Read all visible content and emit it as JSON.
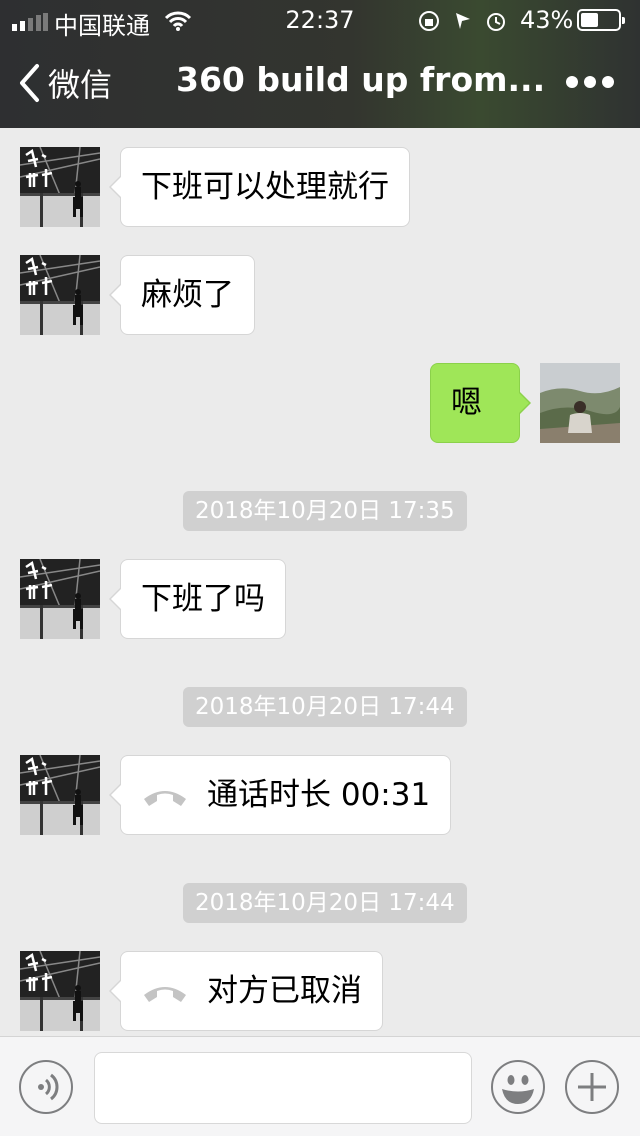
{
  "status_bar": {
    "carrier": "中国联通",
    "time": "22:37",
    "battery_percent": "43%",
    "battery_level": 0.43
  },
  "nav": {
    "back_label": "微信",
    "title": "360 build up from...",
    "icons": {
      "back": "chevron-left-icon",
      "more": "ellipsis-icon"
    }
  },
  "messages": [
    {
      "side": "left",
      "type": "text",
      "text": "下班可以处理就行"
    },
    {
      "side": "left",
      "type": "text",
      "text": "麻烦了"
    },
    {
      "side": "right",
      "type": "text",
      "text": "嗯"
    },
    {
      "type": "timestamp",
      "text": "2018年10月20日 17:35"
    },
    {
      "side": "left",
      "type": "text",
      "text": "下班了吗"
    },
    {
      "type": "timestamp",
      "text": "2018年10月20日 17:44"
    },
    {
      "side": "left",
      "type": "call",
      "text": "通话时长 00:31",
      "icon": "phone-hangup-icon"
    },
    {
      "type": "timestamp",
      "text": "2018年10月20日 17:44"
    },
    {
      "side": "left",
      "type": "call",
      "text": "对方已取消",
      "icon": "phone-hangup-icon"
    }
  ],
  "input_bar": {
    "icons": {
      "voice": "voice-icon",
      "emoji": "emoji-icon",
      "add": "plus-icon"
    },
    "input_value": ""
  },
  "colors": {
    "header_bg": "#2e2f31",
    "chat_bg": "#ebebeb",
    "bubble_in": "#ffffff",
    "bubble_out": "#9fe658",
    "timestamp_bg": "#d0d0d0"
  }
}
